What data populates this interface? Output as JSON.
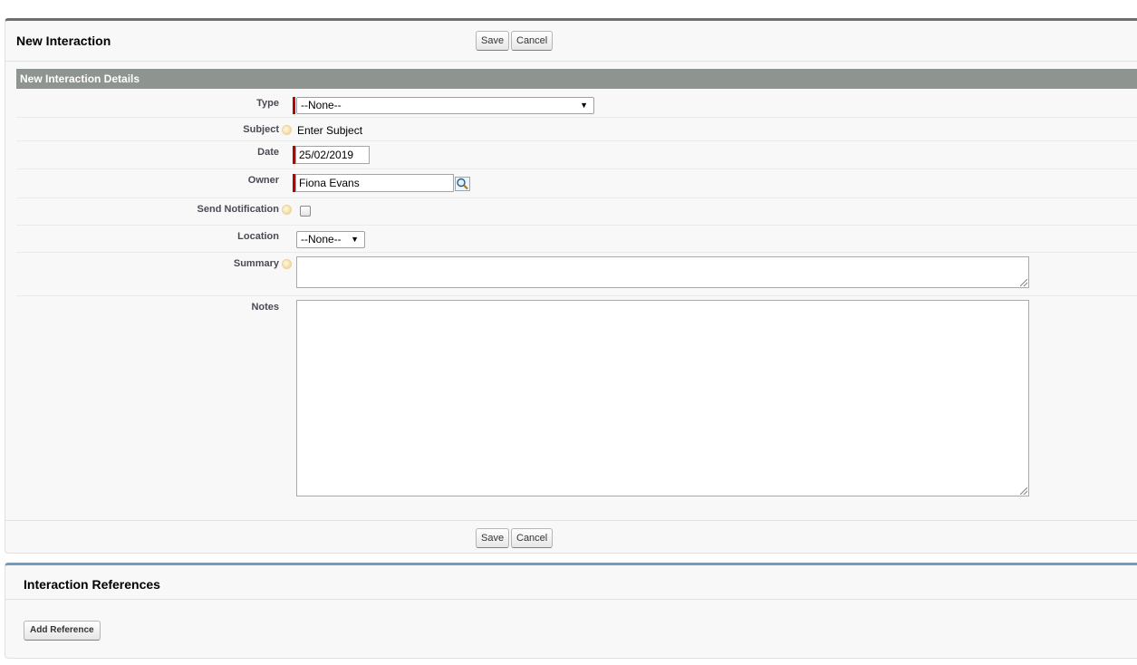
{
  "page": {
    "title": "New Interaction"
  },
  "buttons": {
    "save_label": "Save",
    "cancel_label": "Cancel"
  },
  "section": {
    "title": "New Interaction Details"
  },
  "fields": {
    "type": {
      "label": "Type",
      "value": "--None--"
    },
    "subject": {
      "label": "Subject",
      "value": "Enter Subject"
    },
    "date": {
      "label": "Date",
      "value": "25/02/2019"
    },
    "owner": {
      "label": "Owner",
      "value": "Fiona Evans"
    },
    "send_notification": {
      "label": "Send Notification",
      "checked": false
    },
    "location": {
      "label": "Location",
      "value": "--None--"
    },
    "summary": {
      "label": "Summary",
      "value": ""
    },
    "notes": {
      "label": "Notes",
      "value": ""
    }
  },
  "references": {
    "title": "Interaction References",
    "add_label": "Add Reference"
  },
  "icons": {
    "help": "help-bubble-icon",
    "lookup": "magnifier-lookup-icon",
    "dropdown": "dropdown-arrow-icon"
  },
  "colors": {
    "section_header_bg": "#8e9490",
    "required_bar": "#c00000",
    "panel_top_border": "#6e6e6e",
    "refs_top_border": "#6f9cc4"
  }
}
